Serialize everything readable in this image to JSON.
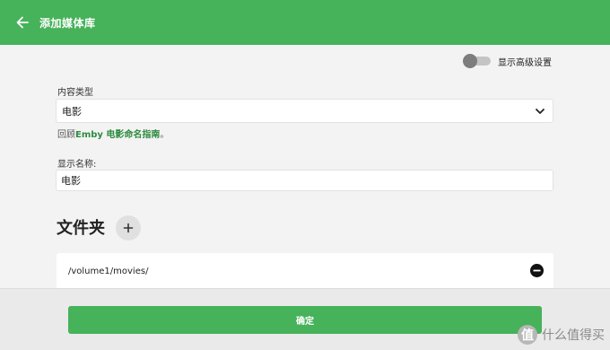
{
  "header": {
    "title": "添加媒体库",
    "color": "#46b25a"
  },
  "advanced_toggle": {
    "label": "显示高级设置",
    "enabled": false
  },
  "content_type": {
    "label": "内容类型",
    "value": "电影"
  },
  "hint": {
    "prefix": "回顾",
    "link_text": "Emby 电影命名指南",
    "suffix": "。"
  },
  "display_name": {
    "label": "显示名称:",
    "value": "电影"
  },
  "folders": {
    "title": "文件夹",
    "items": [
      {
        "path": "/volume1/movies/"
      }
    ]
  },
  "footer": {
    "confirm_label": "确定"
  },
  "watermark": {
    "logo_char": "值",
    "text": "什么值得买"
  }
}
